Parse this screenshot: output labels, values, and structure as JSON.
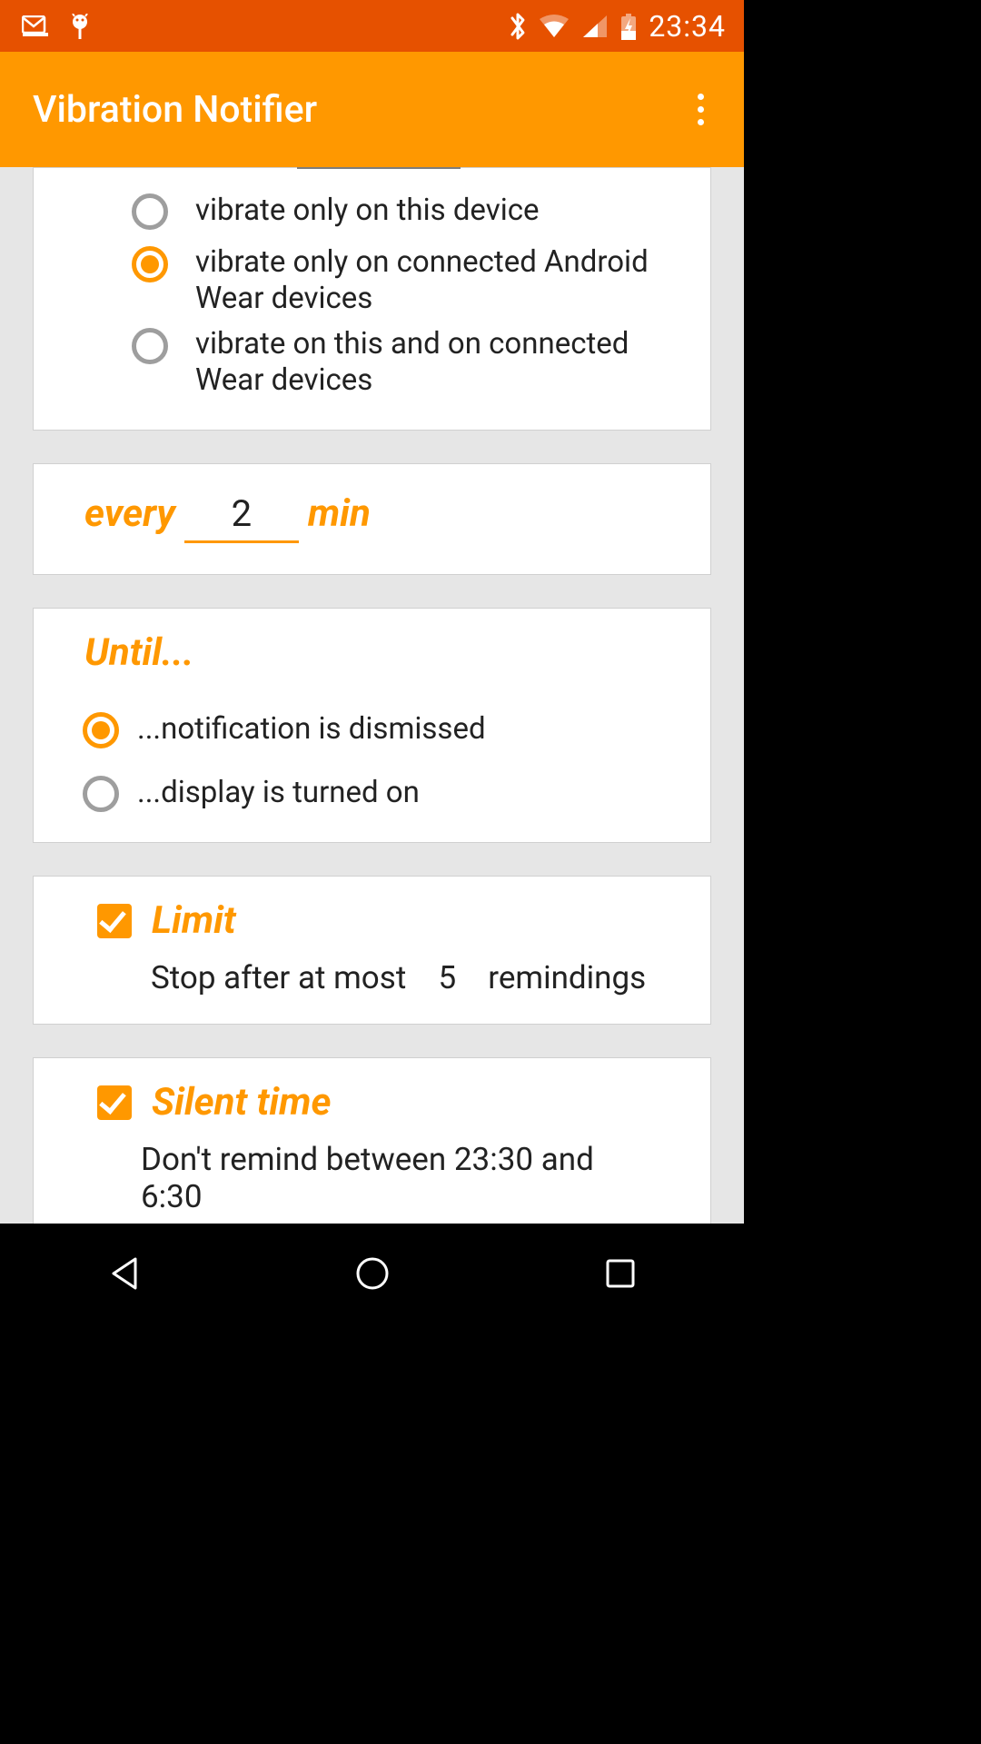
{
  "status": {
    "time": "23:34"
  },
  "appbar": {
    "title": "Vibration Notifier"
  },
  "vibrate_options": {
    "items": [
      {
        "label": "vibrate only on this device",
        "selected": false
      },
      {
        "label": "vibrate only on connected Android Wear devices",
        "selected": true
      },
      {
        "label": "vibrate on this and on connected Wear devices",
        "selected": false
      }
    ]
  },
  "interval": {
    "prefix": "every",
    "value": "2",
    "suffix": "min"
  },
  "until": {
    "title": "Until...",
    "items": [
      {
        "label": "...notification is dismissed",
        "selected": true
      },
      {
        "label": "...display is turned on",
        "selected": false
      }
    ]
  },
  "limit": {
    "checked": true,
    "title": "Limit",
    "prefix": "Stop after at most",
    "count": "5",
    "suffix": "remindings"
  },
  "silent": {
    "checked": true,
    "title": "Silent time",
    "body": "Don't remind between 23:30 and 6:30"
  }
}
